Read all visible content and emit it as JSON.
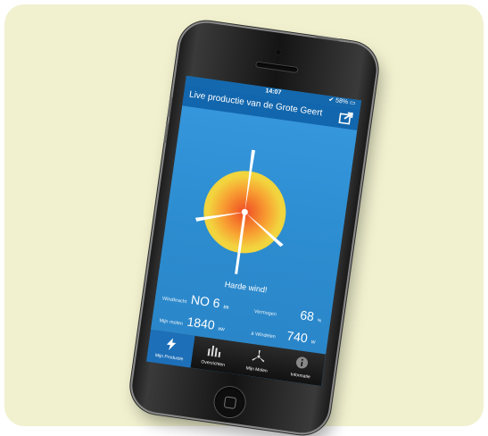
{
  "status_bar": {
    "time": "14:07",
    "battery": "✔ 58% ▭"
  },
  "header": {
    "title": "Live productie van de Grote Geert",
    "share_icon": "share-icon"
  },
  "main": {
    "status_text": "Harde wind!",
    "stats": {
      "windkracht_label": "Windkracht",
      "windkracht_value": "NO 6",
      "windkracht_unit": "Bft",
      "vermogen_label": "Vermogen",
      "vermogen_value": "68",
      "vermogen_unit": "%",
      "mijn_molen_label": "Mijn molen",
      "mijn_molen_value": "1840",
      "mijn_molen_unit": "kW",
      "windeen_label": "à Windelen",
      "windeen_value": "740",
      "windeen_unit": "W"
    }
  },
  "tabs": [
    {
      "label": "Mijn Productie",
      "icon": "lightning-icon"
    },
    {
      "label": "Overzichten",
      "icon": "bar-chart-icon"
    },
    {
      "label": "Mijn Molen",
      "icon": "windmill-icon"
    },
    {
      "label": "Informatie",
      "icon": "info-icon"
    }
  ],
  "colors": {
    "card_bg": "#f1f1cf",
    "screen_blue": "#2d8fd3",
    "nav_blue": "#1266ad",
    "active_tab": "#1d6fb8"
  }
}
